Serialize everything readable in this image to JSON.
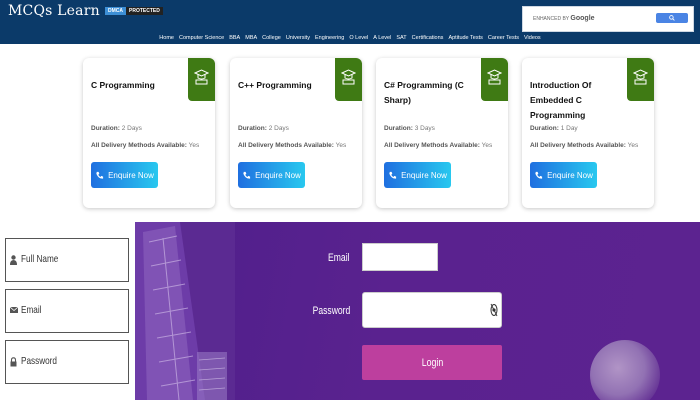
{
  "header": {
    "logo": "MCQs Learn",
    "dmca_badge": [
      "DMCA",
      "PROTECTED"
    ],
    "search": {
      "enhanced_by": "ENHANCED BY",
      "google": "Google"
    },
    "nav": [
      "Home",
      "Computer Science",
      "BBA",
      "MBA",
      "College",
      "University",
      "Engineering",
      "O Level",
      "A Level",
      "SAT",
      "Certifications",
      "Aptitude Tests",
      "Career Tests",
      "Videos"
    ]
  },
  "courses": [
    {
      "title": "C Programming",
      "duration_label": "Duration:",
      "duration": "2 Days",
      "delivery_label": "All Delivery Methods Available:",
      "delivery": "Yes",
      "button": "Enquire Now"
    },
    {
      "title": "C++ Programming",
      "duration_label": "Duration:",
      "duration": "2 Days",
      "delivery_label": "All Delivery Methods Available:",
      "delivery": "Yes",
      "button": "Enquire Now"
    },
    {
      "title": "C# Programming (C Sharp)",
      "duration_label": "Duration:",
      "duration": "3 Days",
      "delivery_label": "All Delivery Methods Available:",
      "delivery": "Yes",
      "button": "Enquire Now"
    },
    {
      "title": "Introduction Of Embedded C Programming",
      "duration_label": "Duration:",
      "duration": "1 Day",
      "delivery_label": "All Delivery Methods Available:",
      "delivery": "Yes",
      "button": "Enquire Now"
    }
  ],
  "left_form": {
    "full_name": "Full Name",
    "email": "Email",
    "password": "Password"
  },
  "login_panel": {
    "email_label": "Email",
    "password_label": "Password",
    "login_button": "Login"
  },
  "colors": {
    "header_bg": "#0b3a69",
    "card_badge": "#3f7a14",
    "enquire_gradient_start": "#1f6fe0",
    "enquire_gradient_end": "#28c8ef",
    "panel_bg": "#56208e",
    "login_button": "#bd3f9e"
  },
  "icons": {
    "card_badge": "graduation-cap-icon",
    "enquire": "phone-icon",
    "full_name": "user-icon",
    "email": "envelope-icon",
    "password": "lock-icon",
    "password_toggle": "eye-icon"
  }
}
